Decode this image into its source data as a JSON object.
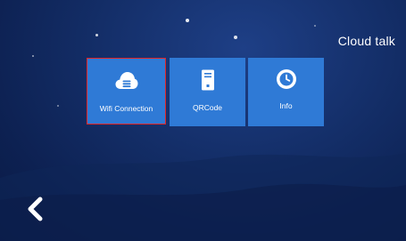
{
  "header": {
    "title": "Cloud talk"
  },
  "menu": {
    "items": [
      {
        "label": "Wifi Connection",
        "icon": "cloud-icon",
        "selected": true
      },
      {
        "label": "QRCode",
        "icon": "qrcode-device-icon",
        "selected": false
      },
      {
        "label": "Info",
        "icon": "clock-info-icon",
        "selected": false
      }
    ]
  },
  "navigation": {
    "back_icon": "chevron-left-icon"
  },
  "colors": {
    "background": "#132d66",
    "tile": "#2f7ad6",
    "selection_border": "#e32626",
    "text": "#ffffff"
  }
}
